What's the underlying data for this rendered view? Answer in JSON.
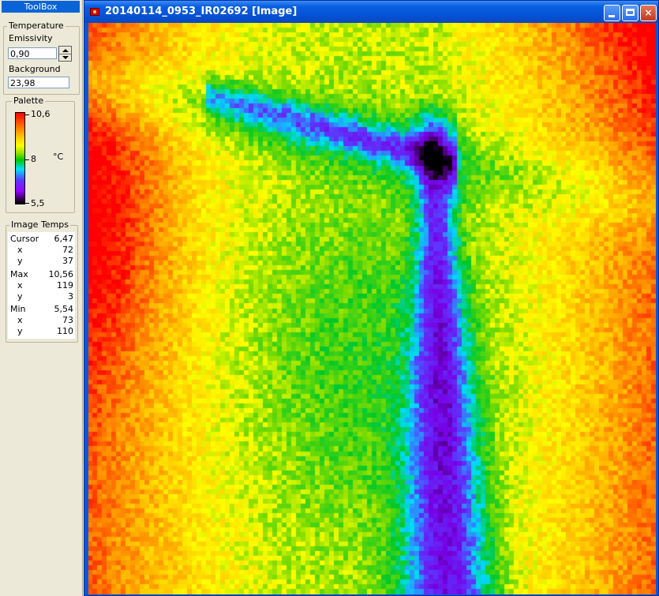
{
  "toolbox": {
    "title": "ToolBox",
    "temperature": {
      "legend": "Temperature",
      "emissivity_label": "Emissivity",
      "emissivity_value": "0,90",
      "background_label": "Background",
      "background_value": "23,98"
    },
    "palette": {
      "legend": "Palette",
      "max_label": "10,6",
      "mid_label": "8",
      "min_label": "5,5",
      "unit": "°C",
      "colors": [
        "#ff0000",
        "#ff6a00",
        "#ffd000",
        "#ffff00",
        "#9be000",
        "#00c800",
        "#00e0ff",
        "#5a3cff",
        "#9400ff",
        "#000000"
      ]
    },
    "image_temps": {
      "legend": "Image Temps",
      "rows": [
        {
          "key": "Cursor",
          "value": "6,47"
        },
        {
          "key": "x",
          "value": "72"
        },
        {
          "key": "y",
          "value": "37"
        },
        {
          "key": "Max",
          "value": "10,56"
        },
        {
          "key": "x",
          "value": "119"
        },
        {
          "key": "y",
          "value": "3"
        },
        {
          "key": "Min",
          "value": "5,54"
        },
        {
          "key": "x",
          "value": "73"
        },
        {
          "key": "y",
          "value": "110"
        }
      ]
    }
  },
  "window": {
    "title": "20140114_0953_IR02692 [Image]",
    "buttons": {
      "minimize": "minimize",
      "maximize": "maximize",
      "close": "×"
    }
  }
}
